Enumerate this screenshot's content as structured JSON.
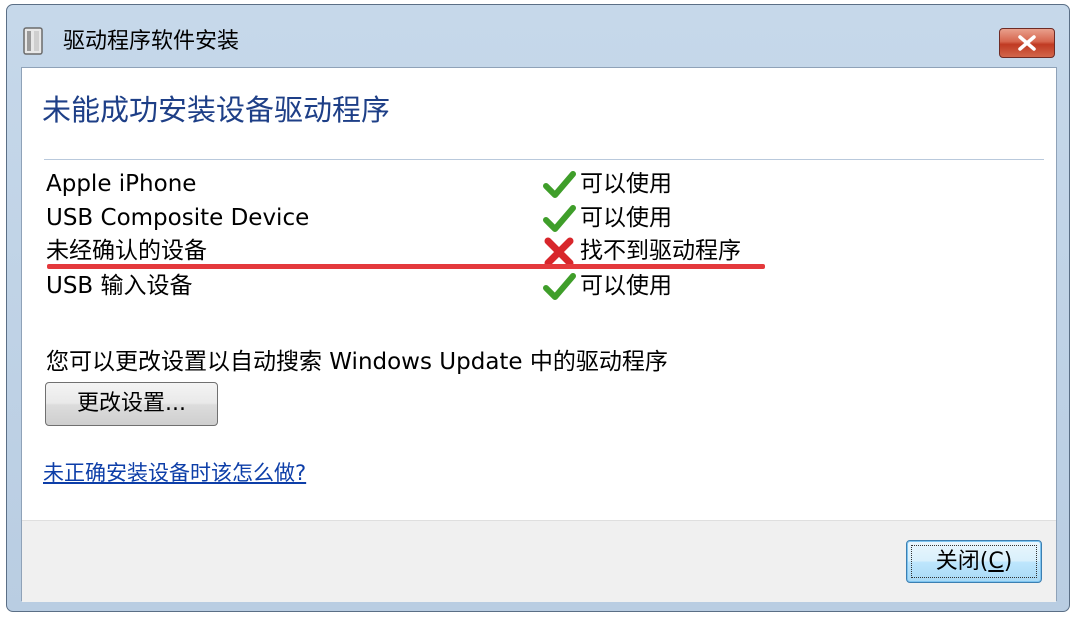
{
  "window": {
    "title": "驱动程序软件安装"
  },
  "main": {
    "heading": "未能成功安装设备驱动程序",
    "devices": [
      {
        "name": "Apple iPhone",
        "status": "可以使用",
        "status_icon": "check-icon"
      },
      {
        "name": "USB Composite Device",
        "status": "可以使用",
        "status_icon": "check-icon"
      },
      {
        "name": "未经确认的设备",
        "status": "找不到驱动程序",
        "status_icon": "error-x-icon"
      },
      {
        "name": "USB 输入设备",
        "status": "可以使用",
        "status_icon": "check-icon"
      }
    ],
    "info_text": "您可以更改设置以自动搜索 Windows Update 中的驱动程序",
    "change_settings_label": "更改设置...",
    "help_link": "未正确安装设备时该怎么做?"
  },
  "footer": {
    "close_label": "关闭(",
    "close_mnemonic": "C",
    "close_label_end": ")"
  },
  "colors": {
    "heading": "#1e3f87",
    "link": "#0d3ea8",
    "annotation_red": "#e4393c",
    "check_green": "#3f9e2a",
    "error_red": "#d8262b"
  }
}
